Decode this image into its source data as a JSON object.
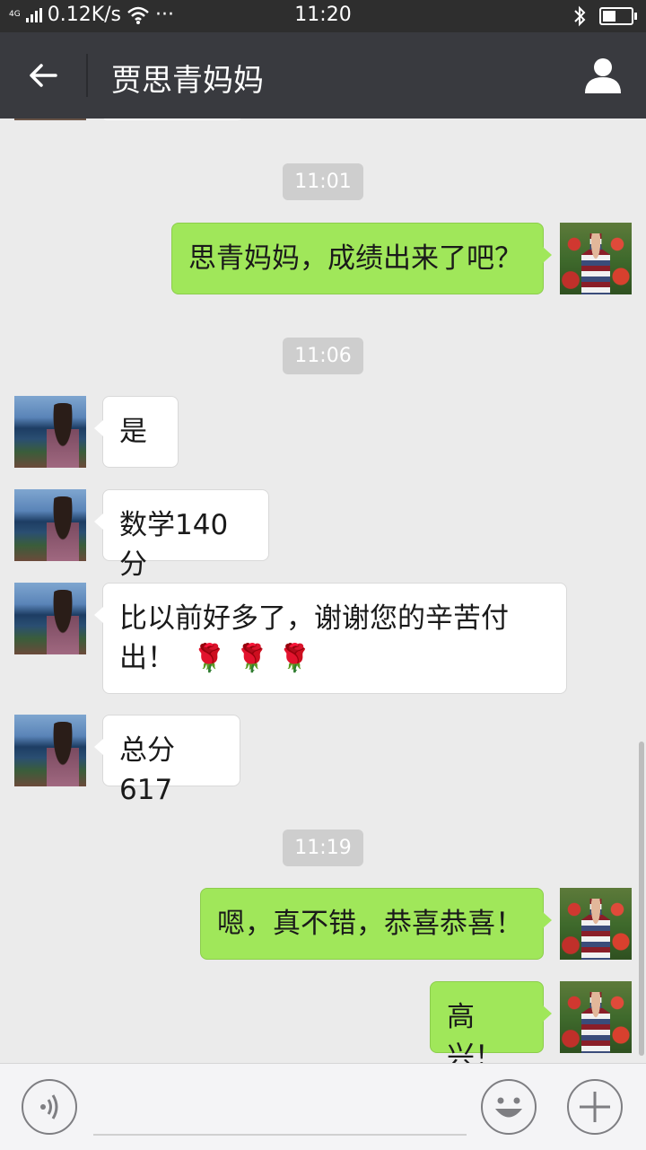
{
  "status_bar": {
    "network": "4G",
    "speed": "0.12K/s",
    "dots": "···",
    "time": "11:20"
  },
  "header": {
    "title": "贾思青妈妈"
  },
  "messages": [
    {
      "type": "time",
      "text": "11:01"
    },
    {
      "type": "out",
      "text": "思青妈妈，成绩出来了吧？"
    },
    {
      "type": "time",
      "text": "11:06"
    },
    {
      "type": "in",
      "text": "是"
    },
    {
      "type": "in",
      "text": "数学140分"
    },
    {
      "type": "in",
      "text_line1": "比以前好多了，谢谢您的辛苦付",
      "text_line2": "出！",
      "emoji": "rose x3"
    },
    {
      "type": "in",
      "text": "总分617"
    },
    {
      "type": "time",
      "text": "11:19"
    },
    {
      "type": "out",
      "text": "嗯，真不错，恭喜恭喜！"
    },
    {
      "type": "out",
      "text": "高兴！"
    }
  ],
  "icons": [
    "back-arrow-icon",
    "profile-icon",
    "voice-icon",
    "emoji-icon",
    "plus-icon",
    "wifi-icon",
    "bluetooth-icon",
    "battery-icon"
  ],
  "colors": {
    "titlebar": "#393a3f",
    "statusbar": "#2e2e2e",
    "background": "#ebebeb",
    "outgoing_bubble": "#a0e75a",
    "incoming_bubble": "#ffffff",
    "timestamp_bg": "#cecece"
  }
}
